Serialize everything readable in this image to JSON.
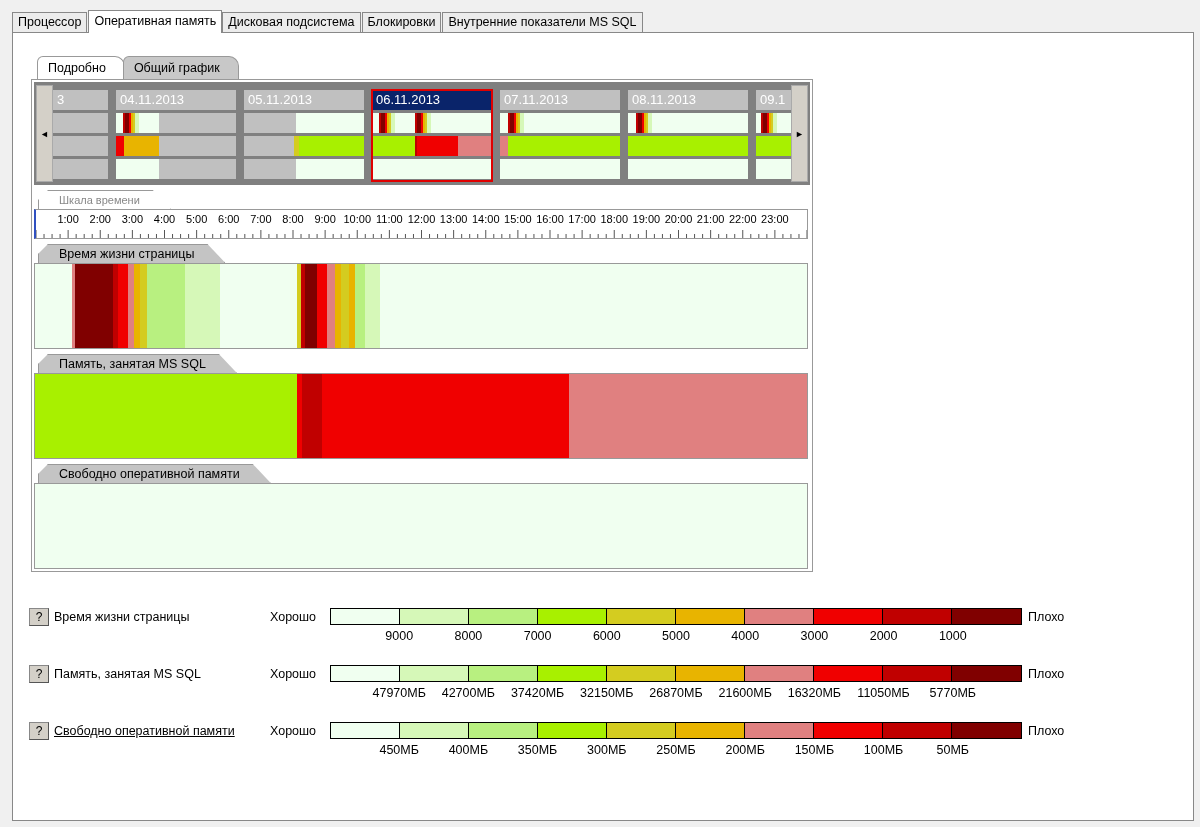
{
  "tabs": [
    {
      "label": "Процессор",
      "selected": false
    },
    {
      "label": "Оперативная память",
      "selected": true
    },
    {
      "label": "Дисковая подсистема",
      "selected": false
    },
    {
      "label": "Блокировки",
      "selected": false
    },
    {
      "label": "Внутренние показатели MS SQL",
      "selected": false
    }
  ],
  "view_tabs": [
    {
      "label": "Подробно",
      "selected": true
    },
    {
      "label": "Общий график",
      "selected": false
    }
  ],
  "timeline": {
    "scroll_left": "◄",
    "scroll_right": "►",
    "days": [
      {
        "date": "3",
        "selected": false
      },
      {
        "date": "04.11.2013",
        "selected": false
      },
      {
        "date": "05.11.2013",
        "selected": false
      },
      {
        "date": "06.11.2013",
        "selected": true
      },
      {
        "date": "07.11.2013",
        "selected": false
      },
      {
        "date": "08.11.2013",
        "selected": false
      },
      {
        "date": "09.1",
        "selected": false
      }
    ]
  },
  "time_scale": {
    "title": "Шкала времени",
    "hours": [
      "1:00",
      "2:00",
      "3:00",
      "4:00",
      "5:00",
      "6:00",
      "7:00",
      "8:00",
      "9:00",
      "10:00",
      "11:00",
      "12:00",
      "13:00",
      "14:00",
      "15:00",
      "16:00",
      "17:00",
      "18:00",
      "19:00",
      "20:00",
      "21:00",
      "22:00",
      "23:00"
    ]
  },
  "sections": [
    {
      "title": "Время жизни страницы"
    },
    {
      "title": "Память, занятая MS SQL"
    },
    {
      "title": "Свободно оперативной памяти"
    }
  ],
  "scale": [
    {
      "color": "#f0fff0"
    },
    {
      "color": "#d6f8b8"
    },
    {
      "color": "#b8f080"
    },
    {
      "color": "#a8f000"
    },
    {
      "color": "#d4cc20"
    },
    {
      "color": "#e8b400"
    },
    {
      "color": "#e08080"
    },
    {
      "color": "#f00000"
    },
    {
      "color": "#c00000"
    },
    {
      "color": "#800000"
    }
  ],
  "legends": [
    {
      "help": "?",
      "name": "Время жизни страницы",
      "underlined": false,
      "good": "Хорошо",
      "bad": "Плохо",
      "ticks": [
        "9000",
        "8000",
        "7000",
        "6000",
        "5000",
        "4000",
        "3000",
        "2000",
        "1000"
      ]
    },
    {
      "help": "?",
      "name": "Память, занятая MS SQL",
      "underlined": false,
      "good": "Хорошо",
      "bad": "Плохо",
      "ticks": [
        "47970МБ",
        "42700МБ",
        "37420МБ",
        "32150МБ",
        "26870МБ",
        "21600МБ",
        "16320МБ",
        "11050МБ",
        "5770МБ"
      ]
    },
    {
      "help": "?",
      "name": "Свободно оперативной памяти",
      "underlined": true,
      "good": "Хорошо",
      "bad": "Плохо",
      "ticks": [
        "450МБ",
        "400МБ",
        "350МБ",
        "300МБ",
        "250МБ",
        "200МБ",
        "150МБ",
        "100МБ",
        "50МБ"
      ]
    }
  ]
}
